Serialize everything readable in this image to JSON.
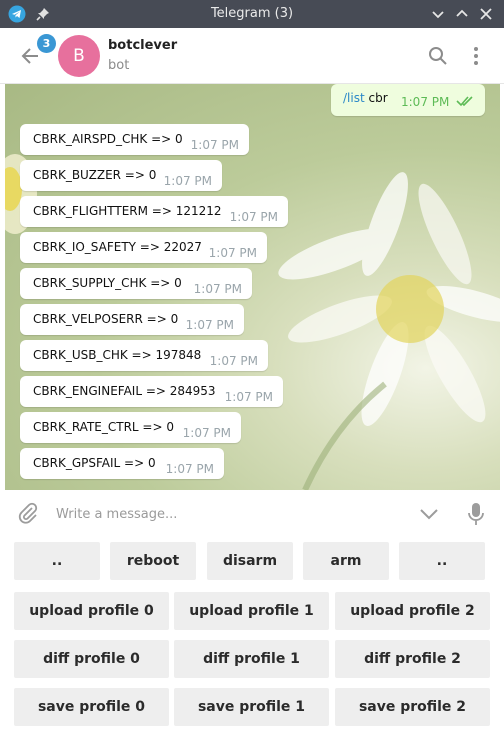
{
  "window": {
    "title": "Telegram (3)"
  },
  "header": {
    "unread_badge": "3",
    "avatar_letter": "B",
    "chat_name": "botclever",
    "chat_status": "bot"
  },
  "outgoing": {
    "command": "/list",
    "argument": " cbr",
    "time": "1:07 PM"
  },
  "messages": [
    {
      "text": "CBRK_AIRSPD_CHK => 0",
      "time": "1:07 PM"
    },
    {
      "text": "CBRK_BUZZER => 0",
      "time": "1:07 PM"
    },
    {
      "text": "CBRK_FLIGHTTERM => 121212",
      "time": "1:07 PM"
    },
    {
      "text": "CBRK_IO_SAFETY => 22027",
      "time": "1:07 PM"
    },
    {
      "text": "CBRK_SUPPLY_CHK => 0",
      "time": "1:07 PM"
    },
    {
      "text": "CBRK_VELPOSERR => 0",
      "time": "1:07 PM"
    },
    {
      "text": "CBRK_USB_CHK => 197848",
      "time": "1:07 PM"
    },
    {
      "text": "CBRK_ENGINEFAIL => 284953",
      "time": "1:07 PM"
    },
    {
      "text": "CBRK_RATE_CTRL => 0",
      "time": "1:07 PM"
    },
    {
      "text": "CBRK_GPSFAIL => 0",
      "time": "1:07 PM"
    }
  ],
  "composer": {
    "placeholder": "Write a message..."
  },
  "keyboard": {
    "row1": [
      "..",
      "reboot",
      "disarm",
      "arm",
      ".."
    ],
    "row2": [
      "upload profile 0",
      "upload profile 1",
      "upload profile 2"
    ],
    "row3": [
      "diff profile 0",
      "diff profile 1",
      "diff profile 2"
    ],
    "row4": [
      "save profile 0",
      "save profile 1",
      "save profile 2"
    ]
  },
  "colors": {
    "titlebar": "#474b55",
    "accent": "#3a97d4",
    "avatar": "#e7709d",
    "outgoing_bubble": "#effdde"
  },
  "icons": [
    "telegram-icon",
    "pin-icon",
    "minimize-icon",
    "maximize-icon",
    "close-icon",
    "back-arrow-icon",
    "search-icon",
    "more-icon",
    "paperclip-icon",
    "chevron-down-icon",
    "microphone-icon",
    "double-check-icon"
  ]
}
